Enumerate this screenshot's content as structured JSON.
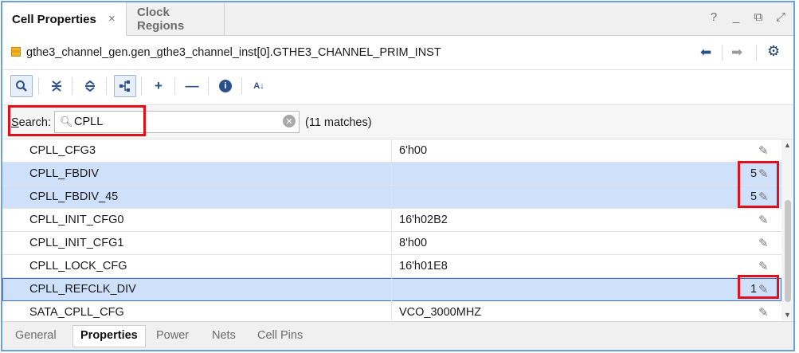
{
  "tabs": {
    "active": "Cell Properties",
    "inactive": "Clock Regions",
    "close_glyph": "×"
  },
  "window_controls": [
    "?",
    "_",
    "⧉",
    "⤢"
  ],
  "path": {
    "text": "gthe3_channel_gen.gen_gthe3_channel_inst[0].GTHE3_CHANNEL_PRIM_INST"
  },
  "toolbar": {
    "icons": [
      "search-icon",
      "collapse-all-icon",
      "expand-all-icon",
      "group-icon",
      "add-icon",
      "remove-icon",
      "info-icon",
      "sort-icon"
    ],
    "plus": "+",
    "minus": "—",
    "info": "i",
    "sort": "A↓"
  },
  "search": {
    "label_underlined": "S",
    "label_rest": "earch:",
    "value": "CPLL",
    "matches": "(11 matches)"
  },
  "rows": [
    {
      "name": "CPLL_CFG3",
      "value": "6'h00",
      "count": ""
    },
    {
      "name": "CPLL_FBDIV",
      "value": "",
      "count": "5"
    },
    {
      "name": "CPLL_FBDIV_45",
      "value": "",
      "count": "5"
    },
    {
      "name": "CPLL_INIT_CFG0",
      "value": "16'h02B2",
      "count": ""
    },
    {
      "name": "CPLL_INIT_CFG1",
      "value": "8'h00",
      "count": ""
    },
    {
      "name": "CPLL_LOCK_CFG",
      "value": "16'h01E8",
      "count": ""
    },
    {
      "name": "CPLL_REFCLK_DIV",
      "value": "",
      "count": "1"
    },
    {
      "name": "SATA_CPLL_CFG",
      "value": "VCO_3000MHZ",
      "count": ""
    }
  ],
  "bottom_tabs": [
    "General",
    "Properties",
    "Power",
    "Nets",
    "Cell Pins"
  ],
  "active_bottom_tab": "Properties",
  "colors": {
    "selection": "#cfe0fb",
    "annotation": "#e0101a",
    "frame": "#6aa0e0"
  }
}
